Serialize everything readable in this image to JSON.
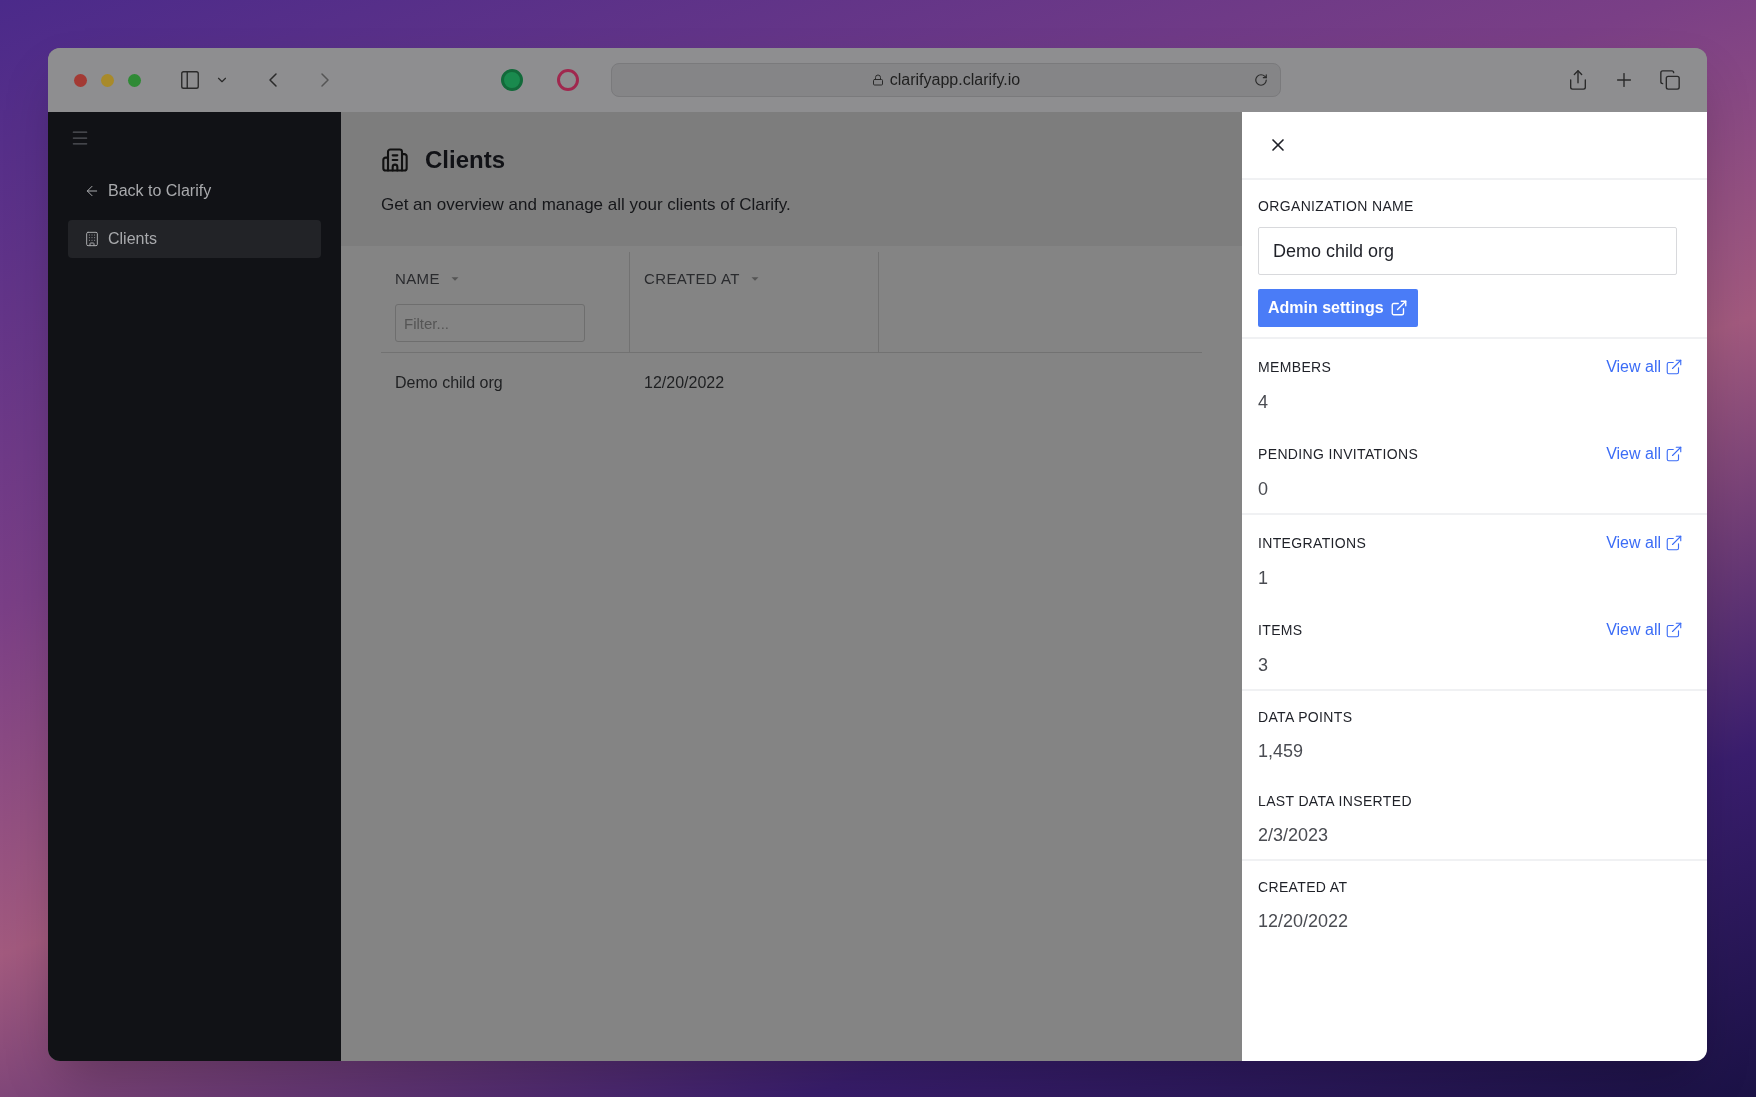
{
  "browser": {
    "url": "clarifyapp.clarify.io"
  },
  "sidebar": {
    "items": [
      {
        "label": "Back to Clarify",
        "kind": "back",
        "selected": false
      },
      {
        "label": "Clients",
        "kind": "page",
        "selected": true
      }
    ]
  },
  "page": {
    "title": "Clients",
    "description": "Get an overview and manage all your clients of Clarify."
  },
  "table": {
    "columns": [
      {
        "label": "NAME",
        "filter_placeholder": "Filter..."
      },
      {
        "label": "CREATED AT"
      }
    ],
    "rows": [
      [
        "Demo child org",
        "12/20/2022"
      ]
    ]
  },
  "panel": {
    "org_label": "ORGANIZATION NAME",
    "org_value": "Demo child org",
    "admin_button": "Admin settings",
    "sections": [
      [
        {
          "label": "MEMBERS",
          "value": "4",
          "link": "View all"
        },
        {
          "label": "PENDING INVITATIONS",
          "value": "0",
          "link": "View all"
        }
      ],
      [
        {
          "label": "INTEGRATIONS",
          "value": "1",
          "link": "View all"
        },
        {
          "label": "ITEMS",
          "value": "3",
          "link": "View all"
        }
      ],
      [
        {
          "label": "DATA POINTS",
          "value": "1,459"
        },
        {
          "label": "LAST DATA INSERTED",
          "value": "2/3/2023"
        }
      ],
      [
        {
          "label": "CREATED AT",
          "value": "12/20/2022"
        }
      ]
    ]
  }
}
